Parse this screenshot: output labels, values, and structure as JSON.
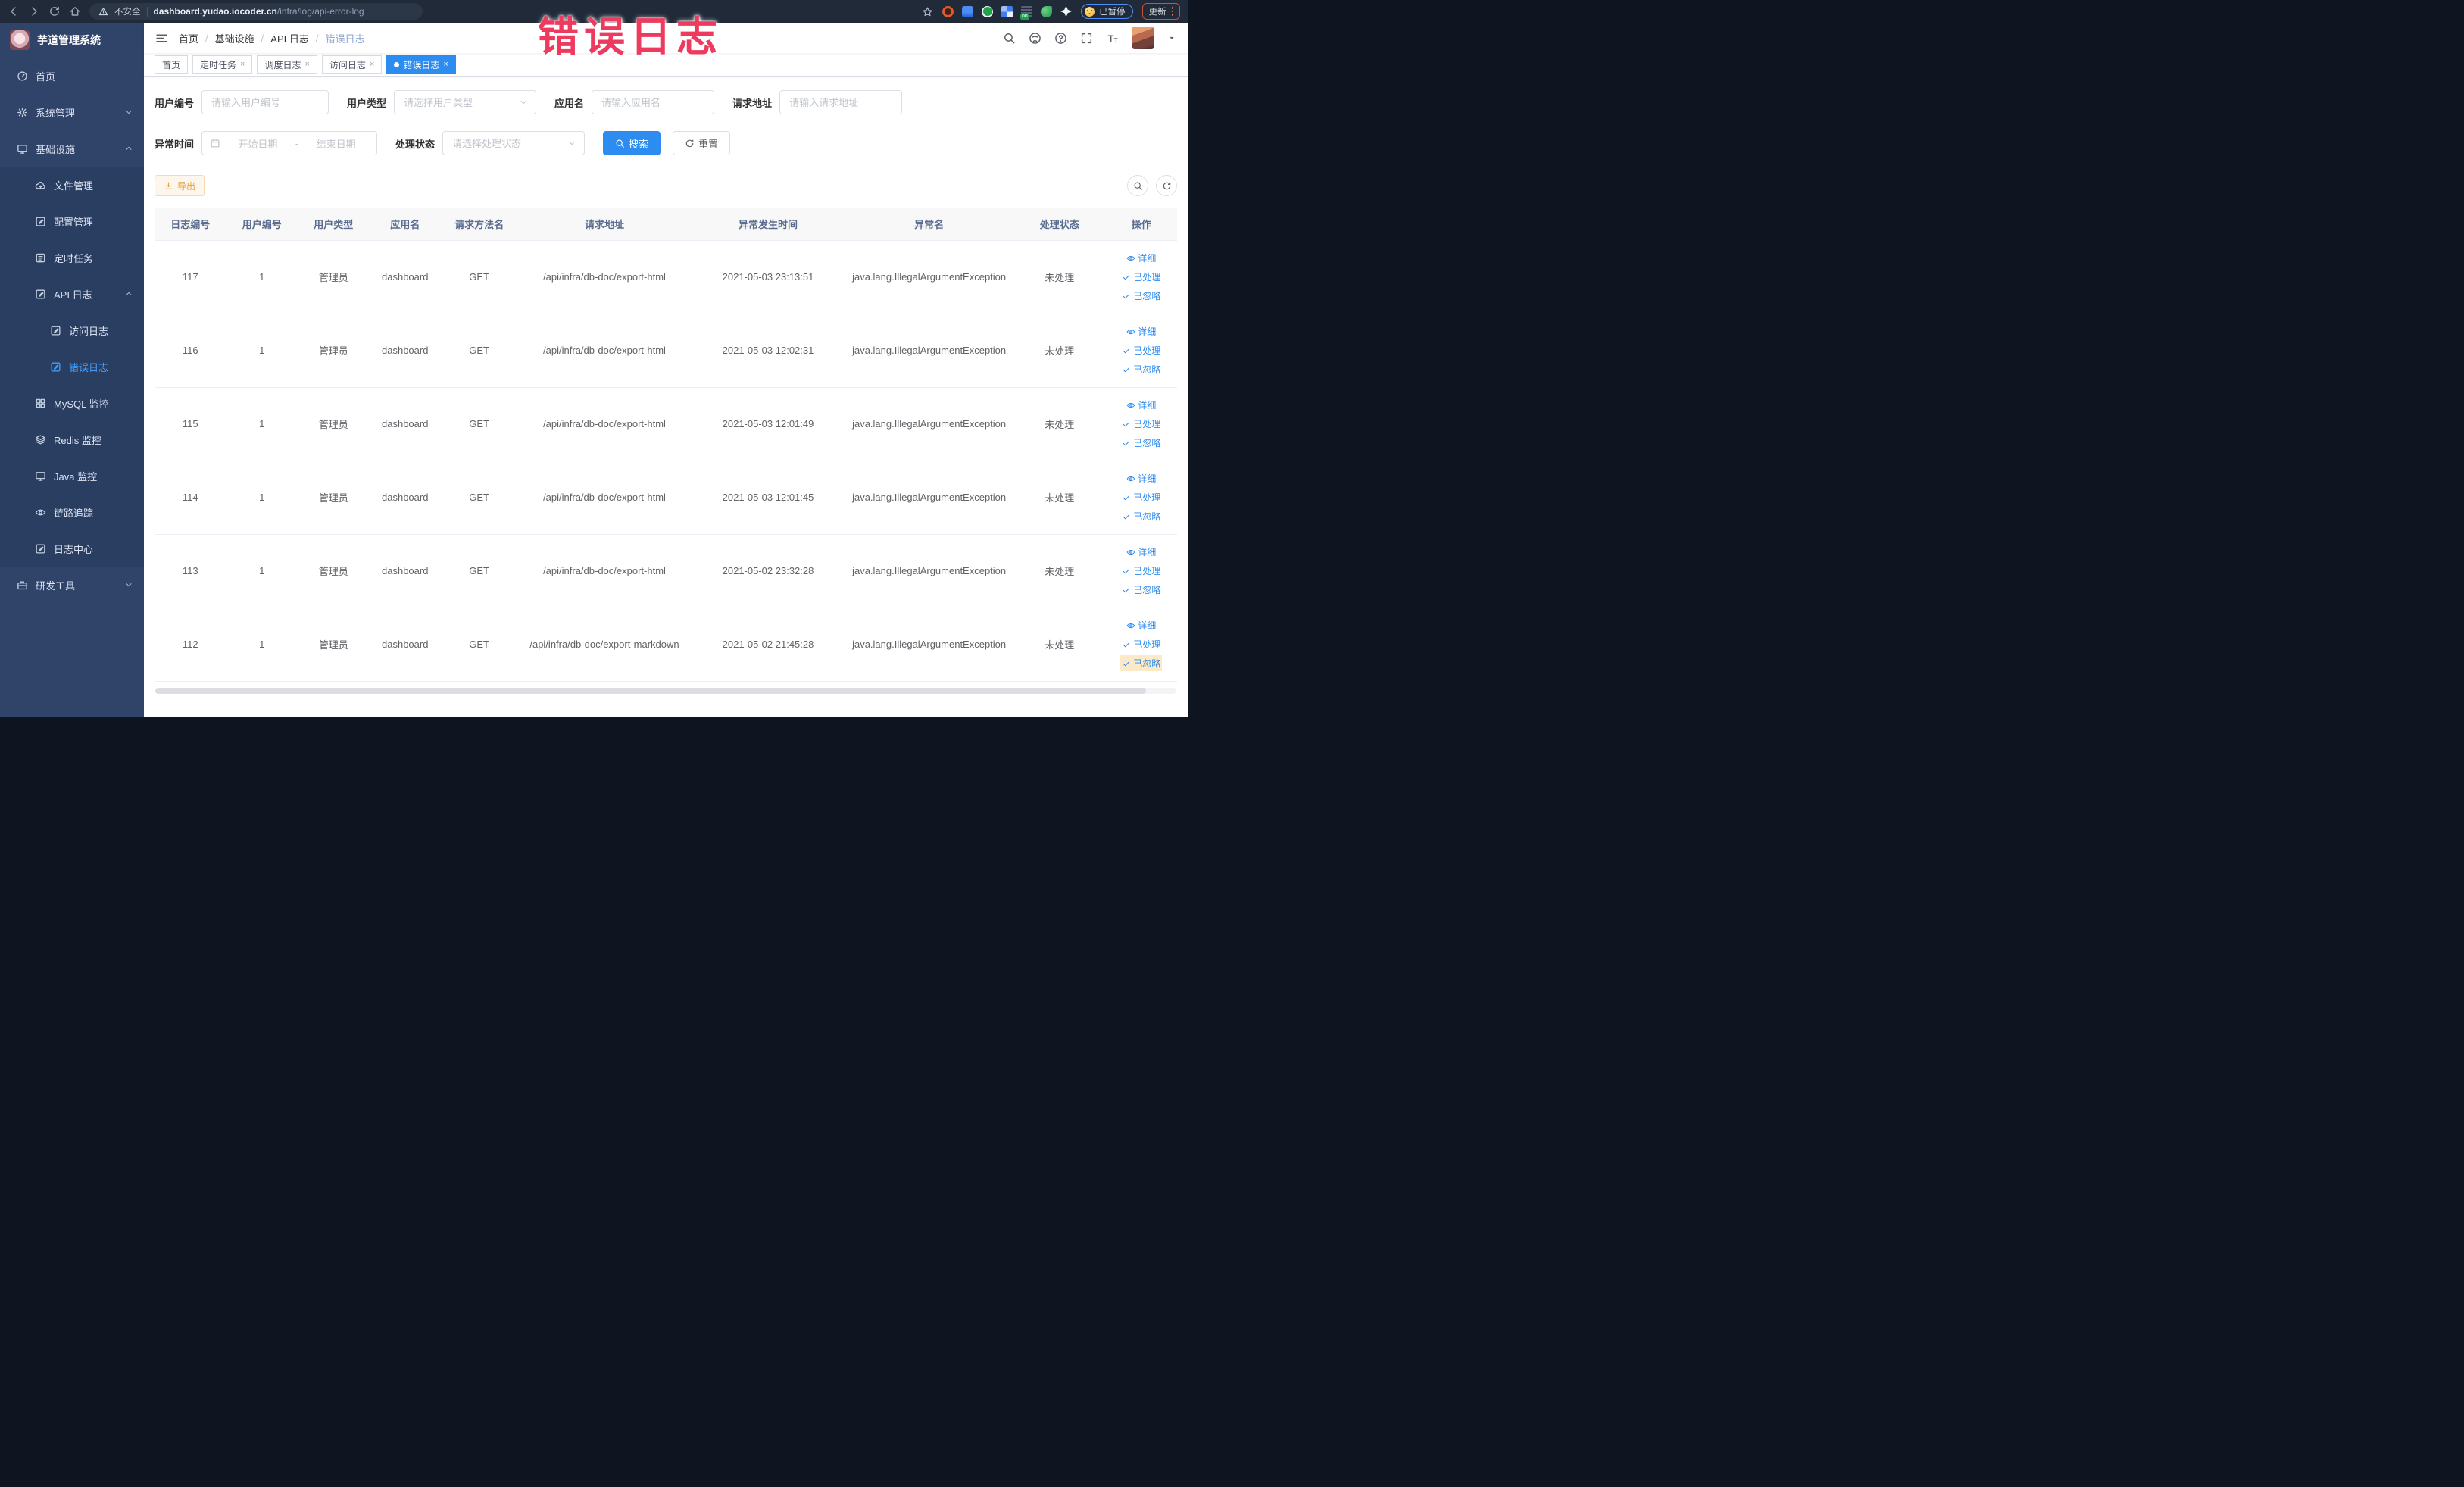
{
  "colors": {
    "accent": "#409eff",
    "tag_active": "#2d8cf0",
    "warning": "#e6a23c",
    "sidebar_bg": "#2f4468",
    "annotation": "#ee3a5f"
  },
  "browser": {
    "security_label": "不安全",
    "url_domain": "dashboard.yudao.iocoder.cn",
    "url_path": "/infra/log/api-error-log",
    "paused_label": "已暂停",
    "update_label": "更新",
    "extensions": [
      {
        "key": "ext-orange-ring",
        "name": "extension-orange-ring-icon"
      },
      {
        "key": "ext-blue-shield",
        "name": "extension-blue-shield-icon"
      },
      {
        "key": "ext-green-check",
        "name": "extension-green-check-icon"
      },
      {
        "key": "ext-blue-grid",
        "name": "extension-blue-grid-icon"
      },
      {
        "key": "ext-on-badge",
        "name": "extension-on-badge-icon"
      },
      {
        "key": "ext-green-leaf",
        "name": "extension-green-leaf-icon"
      },
      {
        "key": "ext-white-pinwheel",
        "name": "extension-pinwheel-icon"
      }
    ]
  },
  "annotation": {
    "text": "错误日志"
  },
  "sidebar": {
    "app_title": "芋道管理系统",
    "items": [
      {
        "key": "home",
        "label": "首页",
        "icon": "gauge-icon",
        "path": "gauge",
        "level": 1
      },
      {
        "key": "system-management",
        "label": "系统管理",
        "icon": "gear-icon",
        "path": "gear",
        "level": 1,
        "chevron": "down"
      },
      {
        "key": "infrastructure",
        "label": "基础设施",
        "icon": "infra-icon",
        "path": "monitor",
        "level": 1,
        "chevron": "up"
      },
      {
        "key": "file-management",
        "label": "文件管理",
        "icon": "cloud-upload-icon",
        "path": "cloud",
        "level": 2
      },
      {
        "key": "config-management",
        "label": "配置管理",
        "icon": "edit-icon",
        "path": "editsq",
        "level": 2
      },
      {
        "key": "scheduled-tasks",
        "label": "定时任务",
        "icon": "task-list-icon",
        "path": "list",
        "level": 2
      },
      {
        "key": "api-log",
        "label": "API 日志",
        "icon": "log-icon",
        "path": "editsq",
        "level": 2,
        "chevron": "up"
      },
      {
        "key": "access-log",
        "label": "访问日志",
        "icon": "log-icon",
        "path": "editsq",
        "level": 3
      },
      {
        "key": "error-log",
        "label": "错误日志",
        "icon": "log-icon",
        "path": "editsq",
        "level": 3,
        "active": true
      },
      {
        "key": "mysql-monitor",
        "label": "MySQL 监控",
        "icon": "mysql-icon",
        "path": "grid",
        "level": 2
      },
      {
        "key": "redis-monitor",
        "label": "Redis 监控",
        "icon": "redis-icon",
        "path": "layers",
        "level": 2
      },
      {
        "key": "java-monitor",
        "label": "Java 监控",
        "icon": "java-icon",
        "path": "monitor",
        "level": 2
      },
      {
        "key": "trace",
        "label": "链路追踪",
        "icon": "trace-eye-icon",
        "path": "eye",
        "level": 2
      },
      {
        "key": "log-center",
        "label": "日志中心",
        "icon": "log-icon",
        "path": "editsq",
        "level": 2
      },
      {
        "key": "dev-tools",
        "label": "研发工具",
        "icon": "tools-icon",
        "path": "briefcase",
        "level": 1,
        "chevron": "down"
      }
    ]
  },
  "header": {
    "breadcrumb": [
      "首页",
      "基础设施",
      "API 日志",
      "错误日志"
    ]
  },
  "tabs": [
    {
      "label": "首页",
      "closable": false,
      "active": false
    },
    {
      "label": "定时任务",
      "closable": true,
      "active": false
    },
    {
      "label": "调度日志",
      "closable": true,
      "active": false
    },
    {
      "label": "访问日志",
      "closable": true,
      "active": false
    },
    {
      "label": "错误日志",
      "closable": true,
      "active": true
    }
  ],
  "filters": {
    "user_id": {
      "label": "用户编号",
      "placeholder": "请输入用户编号"
    },
    "user_type": {
      "label": "用户类型",
      "placeholder": "请选择用户类型"
    },
    "app_name": {
      "label": "应用名",
      "placeholder": "请输入应用名"
    },
    "request_url": {
      "label": "请求地址",
      "placeholder": "请输入请求地址"
    },
    "exception_time": {
      "label": "异常时间",
      "start_placeholder": "开始日期",
      "separator": "-",
      "end_placeholder": "结束日期"
    },
    "process_status": {
      "label": "处理状态",
      "placeholder": "请选择处理状态"
    },
    "search_label": "搜索",
    "reset_label": "重置"
  },
  "toolbar": {
    "export_label": "导出"
  },
  "table": {
    "columns": [
      "日志编号",
      "用户编号",
      "用户类型",
      "应用名",
      "请求方法名",
      "请求地址",
      "异常发生时间",
      "异常名",
      "处理状态",
      "操作"
    ],
    "actions": {
      "detail": "详细",
      "processed": "已处理",
      "ignored": "已忽略"
    },
    "rows": [
      {
        "id": "117",
        "user_id": "1",
        "user_type": "管理员",
        "app_name": "dashboard",
        "method": "GET",
        "url": "/api/infra/db-doc/export-html",
        "time": "2021-05-03 23:13:51",
        "exception": "java.lang.IllegalArgumentException",
        "status": "未处理"
      },
      {
        "id": "116",
        "user_id": "1",
        "user_type": "管理员",
        "app_name": "dashboard",
        "method": "GET",
        "url": "/api/infra/db-doc/export-html",
        "time": "2021-05-03 12:02:31",
        "exception": "java.lang.IllegalArgumentException",
        "status": "未处理"
      },
      {
        "id": "115",
        "user_id": "1",
        "user_type": "管理员",
        "app_name": "dashboard",
        "method": "GET",
        "url": "/api/infra/db-doc/export-html",
        "time": "2021-05-03 12:01:49",
        "exception": "java.lang.IllegalArgumentException",
        "status": "未处理"
      },
      {
        "id": "114",
        "user_id": "1",
        "user_type": "管理员",
        "app_name": "dashboard",
        "method": "GET",
        "url": "/api/infra/db-doc/export-html",
        "time": "2021-05-03 12:01:45",
        "exception": "java.lang.IllegalArgumentException",
        "status": "未处理"
      },
      {
        "id": "113",
        "user_id": "1",
        "user_type": "管理员",
        "app_name": "dashboard",
        "method": "GET",
        "url": "/api/infra/db-doc/export-html",
        "time": "2021-05-02 23:32:28",
        "exception": "java.lang.IllegalArgumentException",
        "status": "未处理"
      },
      {
        "id": "112",
        "user_id": "1",
        "user_type": "管理员",
        "app_name": "dashboard",
        "method": "GET",
        "url": "/api/infra/db-doc/export-markdown",
        "time": "2021-05-02 21:45:28",
        "exception": "java.lang.IllegalArgumentException",
        "status": "未处理",
        "ignored_highlighted": true
      }
    ]
  }
}
